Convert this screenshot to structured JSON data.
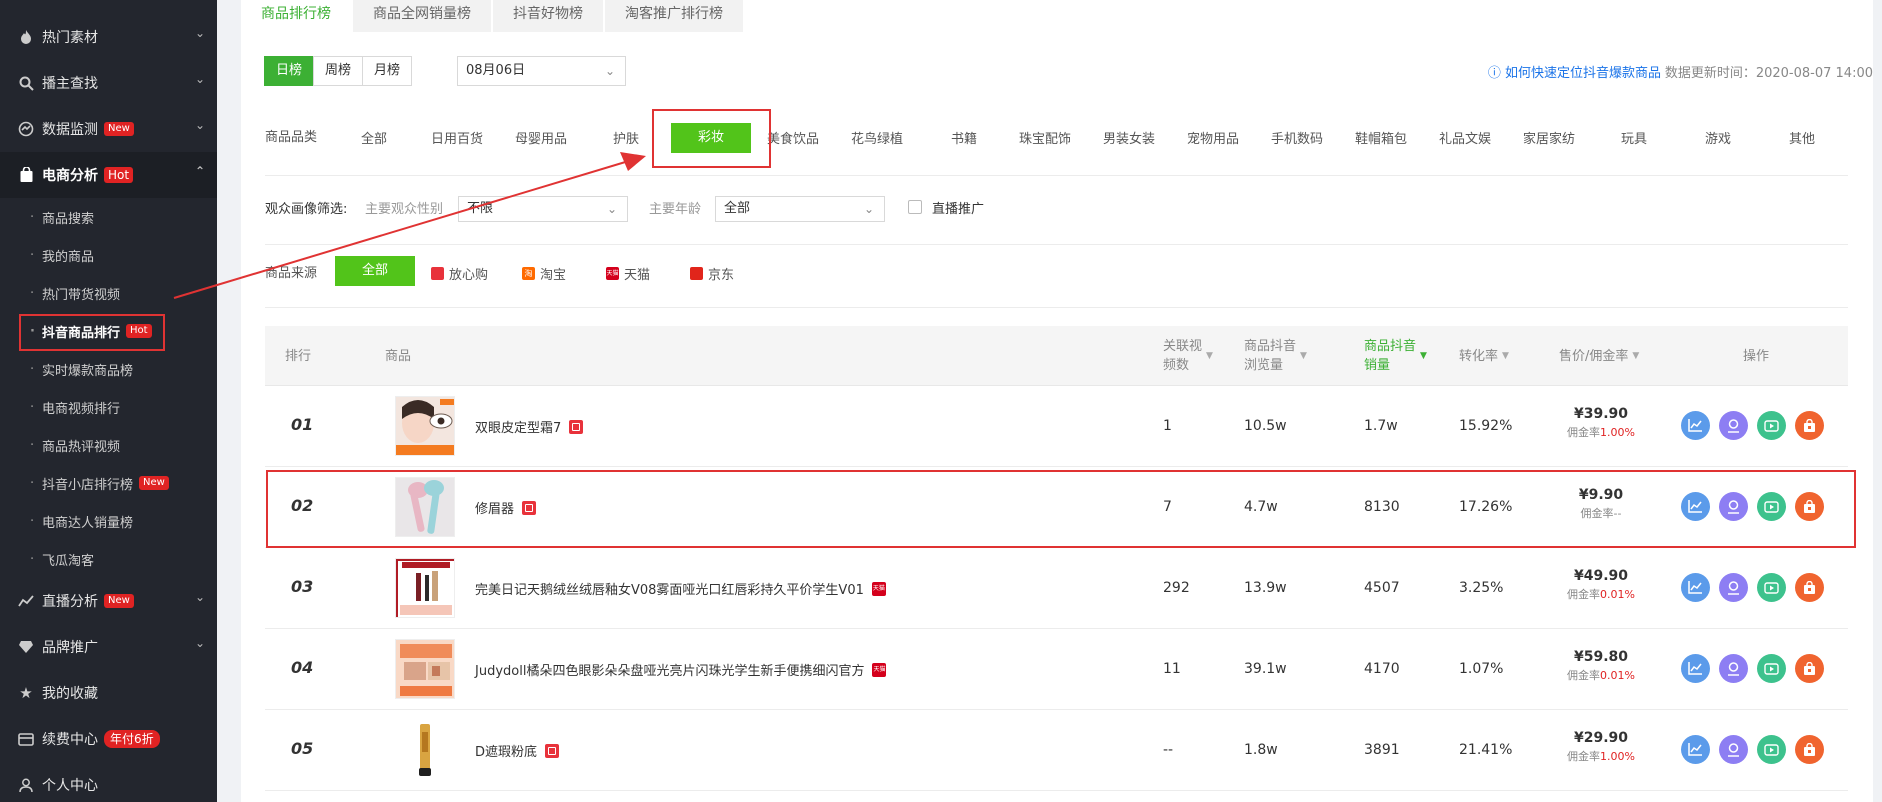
{
  "sidebar": {
    "groups": [
      {
        "label": "热门素材",
        "icon": "flame-icon"
      },
      {
        "label": "播主查找",
        "icon": "search-icon"
      },
      {
        "label": "数据监测",
        "icon": "monitor-icon",
        "badge": "New"
      },
      {
        "label": "电商分析",
        "icon": "shopping-bag-icon",
        "badge": "Hot"
      },
      {
        "label": "直播分析",
        "icon": "trend-icon",
        "badge": "New"
      },
      {
        "label": "品牌推广",
        "icon": "diamond-icon"
      },
      {
        "label": "我的收藏",
        "icon": "star-icon"
      },
      {
        "label": "续费中心",
        "icon": "wallet-icon",
        "badge": "年付6折"
      },
      {
        "label": "个人中心",
        "icon": "person-icon"
      }
    ],
    "sub_items": [
      {
        "label": "商品搜索"
      },
      {
        "label": "我的商品"
      },
      {
        "label": "热门带货视频"
      },
      {
        "label": "抖音商品排行",
        "badge": "Hot"
      },
      {
        "label": "实时爆款商品榜"
      },
      {
        "label": "电商视频排行"
      },
      {
        "label": "商品热评视频"
      },
      {
        "label": "抖音小店排行榜",
        "badge": "New"
      },
      {
        "label": "电商达人销量榜"
      },
      {
        "label": "飞瓜淘客"
      }
    ]
  },
  "tabs": [
    "商品排行榜",
    "商品全网销量榜",
    "抖音好物榜",
    "淘客推广排行榜"
  ],
  "period": {
    "buttons": [
      "日榜",
      "周榜",
      "月榜"
    ],
    "date": "08月06日"
  },
  "help_link": "如何快速定位抖音爆款商品",
  "update_time": "数据更新时间：2020-08-07 14:00",
  "category": {
    "label": "商品品类",
    "items": [
      "全部",
      "日用百货",
      "母婴用品",
      "护肤",
      "彩妆",
      "美食饮品",
      "花鸟绿植",
      "书籍",
      "珠宝配饰",
      "男装女装",
      "宠物用品",
      "手机数码",
      "鞋帽箱包",
      "礼品文娱",
      "家居家纺",
      "玩具",
      "游戏",
      "其他"
    ]
  },
  "audience": {
    "label": "观众画像筛选:",
    "gender_label": "主要观众性别",
    "gender_value": "不限",
    "age_label": "主要年龄",
    "age_value": "全部",
    "live_label": "直播推广"
  },
  "source": {
    "label": "商品来源",
    "items": [
      "全部",
      "放心购",
      "淘宝",
      "天猫",
      "京东"
    ],
    "tmall_mark": "天猫",
    "taobao_mark": "淘"
  },
  "table": {
    "headers": {
      "rank": "排行",
      "product": "商品",
      "videos": [
        "关联视",
        "频数"
      ],
      "views": [
        "商品抖音",
        "浏览量"
      ],
      "sales": [
        "商品抖音",
        "销量"
      ],
      "conversion": "转化率",
      "price": "售价/佣金率",
      "ops": "操作"
    },
    "commission_prefix": "佣金率",
    "rows": [
      {
        "rank": "01",
        "name": "双眼皮定型霜7",
        "platform": "放心购",
        "videos": "1",
        "views": "10.5w",
        "sales": "1.7w",
        "conversion": "15.92%",
        "price": "¥39.90",
        "commission": "1.00%",
        "thumb_text": "一支双眼皮"
      },
      {
        "rank": "02",
        "name": "修眉器",
        "platform": "放心购",
        "videos": "7",
        "views": "4.7w",
        "sales": "8130",
        "conversion": "17.26%",
        "price": "¥9.90",
        "commission": "--"
      },
      {
        "rank": "03",
        "name": "完美日记天鹅绒丝绒唇釉女V08雾面哑光口红唇彩持久平价学生V01",
        "platform": "天猫",
        "videos": "292",
        "views": "13.9w",
        "sales": "4507",
        "conversion": "3.25%",
        "price": "¥49.90",
        "commission": "0.01%"
      },
      {
        "rank": "04",
        "name": "Judydoll橘朵四色眼影朵朵盘哑光亮片闪珠光学生新手便携细闪官方",
        "platform": "天猫",
        "videos": "11",
        "views": "39.1w",
        "sales": "4170",
        "conversion": "1.07%",
        "price": "¥59.80",
        "commission": "0.01%"
      },
      {
        "rank": "05",
        "name": "D遮瑕粉底",
        "platform": "放心购",
        "videos": "--",
        "views": "1.8w",
        "sales": "3891",
        "conversion": "21.41%",
        "price": "¥29.90",
        "commission": "1.00%"
      }
    ]
  },
  "colors": {
    "accent": "#52c41a",
    "annotation": "#e03333",
    "sidebar_bg": "#23262e"
  }
}
